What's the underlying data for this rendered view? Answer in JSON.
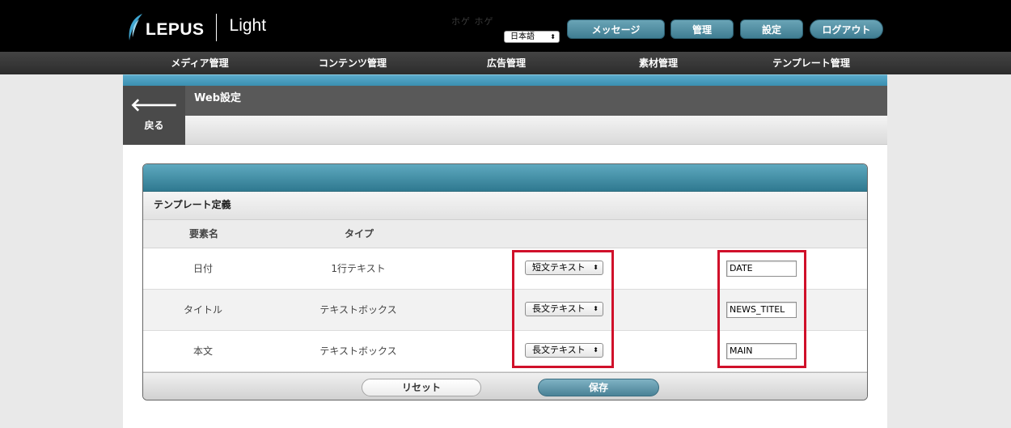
{
  "header": {
    "logo_text": "LEPUS",
    "edition": "Light",
    "user_name": "ホゲ ホゲ",
    "language": "日本語",
    "buttons": {
      "message": "メッセージ",
      "admin": "管理",
      "settings": "設定",
      "logout": "ログアウト"
    },
    "colors": {
      "background": "#000000",
      "button": "#4f8ea3"
    }
  },
  "nav": {
    "items": [
      "メディア管理",
      "コンテンツ管理",
      "広告管理",
      "素材管理",
      "テンプレート管理"
    ]
  },
  "page": {
    "back_label": "戻る",
    "title": "Web設定"
  },
  "template": {
    "section_title": "テンプレート定義",
    "columns": {
      "element_name": "要素名",
      "type": "タイプ"
    },
    "rows": [
      {
        "name": "日付",
        "type": "1行テキスト",
        "select": "短文テキスト",
        "value": "DATE"
      },
      {
        "name": "タイトル",
        "type": "テキストボックス",
        "select": "長文テキスト",
        "value": "NEWS_TITEL"
      },
      {
        "name": "本文",
        "type": "テキストボックス",
        "select": "長文テキスト",
        "value": "MAIN"
      }
    ],
    "reset_label": "リセット",
    "save_label": "保存",
    "highlight_color": "#d0102a"
  }
}
